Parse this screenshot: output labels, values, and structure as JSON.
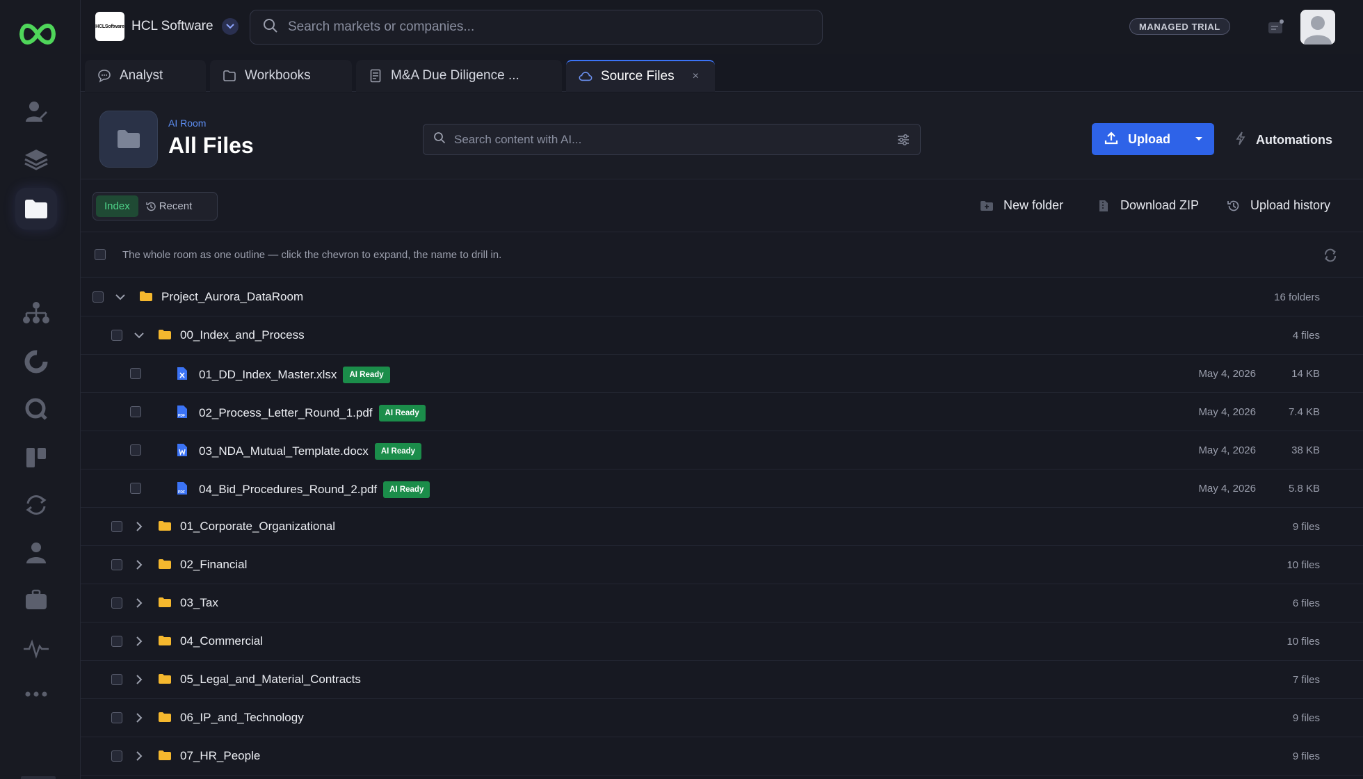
{
  "topbar": {
    "brand_logo_text": "HCLSoftware",
    "brand_name": "HCL Software",
    "search_placeholder": "Search markets or companies...",
    "trial_badge": "MANAGED TRIAL"
  },
  "tabs": [
    {
      "label": "Analyst",
      "icon": "chat-bubble-icon"
    },
    {
      "label": "Workbooks",
      "icon": "folder-outline-icon"
    },
    {
      "label": "M&A Due Diligence ...",
      "icon": "document-icon"
    },
    {
      "label": "Source Files",
      "icon": "cloud-icon",
      "close": "×"
    }
  ],
  "header": {
    "breadcrumb": "AI Room",
    "title": "All Files",
    "ai_search_placeholder": "Search content with AI...",
    "upload_label": "Upload",
    "automations_label": "Automations"
  },
  "toolbar": {
    "index_label": "Index",
    "recent_label": "Recent",
    "new_folder": "New folder",
    "download_zip": "Download ZIP",
    "upload_history": "Upload history"
  },
  "hint": "The whole room as one outline — click the chevron to expand, the name to drill in.",
  "tree": {
    "root": {
      "name": "Project_Aurora_DataRoom",
      "meta": "16 folders"
    },
    "index_folder": {
      "name": "00_Index_and_Process",
      "meta": "4 files"
    },
    "files": [
      {
        "name": "01_DD_Index_Master.xlsx",
        "badge": "AI Ready",
        "date": "May 4, 2026",
        "size": "14 KB",
        "type": "xlsx"
      },
      {
        "name": "02_Process_Letter_Round_1.pdf",
        "badge": "AI Ready",
        "date": "May 4, 2026",
        "size": "7.4 KB",
        "type": "pdf"
      },
      {
        "name": "03_NDA_Mutual_Template.docx",
        "badge": "AI Ready",
        "date": "May 4, 2026",
        "size": "38 KB",
        "type": "docx"
      },
      {
        "name": "04_Bid_Procedures_Round_2.pdf",
        "badge": "AI Ready",
        "date": "May 4, 2026",
        "size": "5.8 KB",
        "type": "pdf"
      }
    ],
    "folders": [
      {
        "name": "01_Corporate_Organizational",
        "meta": "9 files"
      },
      {
        "name": "02_Financial",
        "meta": "10 files"
      },
      {
        "name": "03_Tax",
        "meta": "6 files"
      },
      {
        "name": "04_Commercial",
        "meta": "10 files"
      },
      {
        "name": "05_Legal_and_Material_Contracts",
        "meta": "7 files"
      },
      {
        "name": "06_IP_and_Technology",
        "meta": "9 files"
      },
      {
        "name": "07_HR_People",
        "meta": "9 files"
      }
    ]
  },
  "colors": {
    "accent_blue": "#2e63e8",
    "ai_ready_green": "#1b8d4a",
    "folder_yellow": "#f5b82e",
    "logo_green": "#4fd65a"
  }
}
